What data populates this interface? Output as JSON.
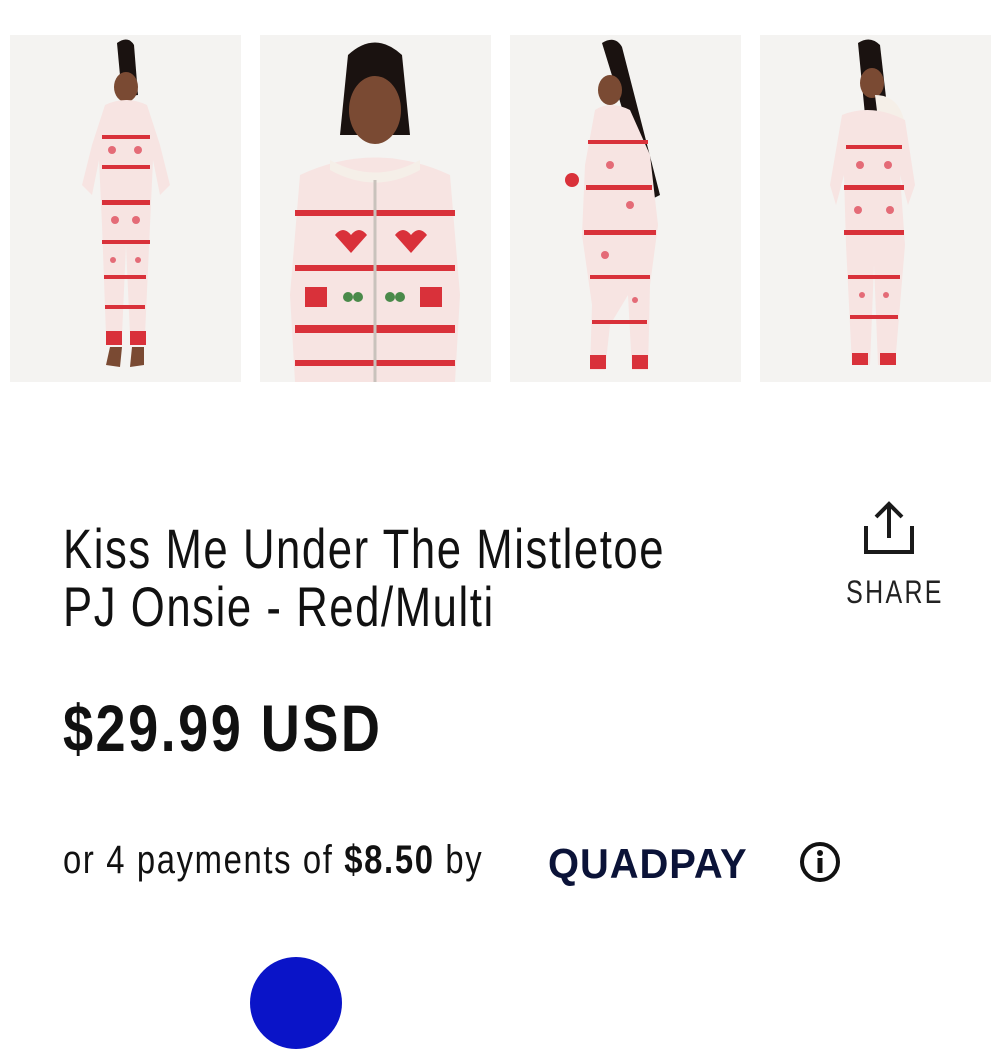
{
  "gallery": {
    "images": [
      {
        "alt": "front-full"
      },
      {
        "alt": "front-closeup"
      },
      {
        "alt": "side-full"
      },
      {
        "alt": "back-full"
      }
    ]
  },
  "product": {
    "title_line1": "Kiss Me Under The Mistletoe",
    "title_line2": "PJ Onsie - Red/Multi",
    "price": "$29.99 USD"
  },
  "share": {
    "label": "SHARE",
    "icon": "share-icon"
  },
  "installments": {
    "prefix": "or 4 payments of ",
    "amount": "$8.50",
    "suffix": " by",
    "provider": "QUADPAY",
    "provider_color": "#0b1338",
    "icon": "info-icon"
  },
  "colors": {
    "swatch_blue": "#0a14c8",
    "pattern_red": "#d9313a"
  }
}
